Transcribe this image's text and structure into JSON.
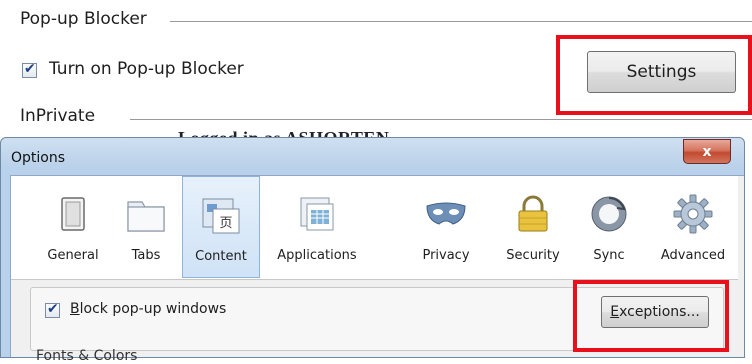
{
  "ie_panel": {
    "popup_section_title": "Pop-up Blocker",
    "popup_checkbox_label": "Turn on Pop-up Blocker",
    "popup_checked": true,
    "settings_button": "Settings",
    "inprivate_section_title": "InPrivate"
  },
  "background_text": "Logged in as ASHORTEN",
  "dialog": {
    "title": "Options",
    "close_glyph": "x",
    "tabs": [
      {
        "label": "General",
        "icon": "general-switch-icon"
      },
      {
        "label": "Tabs",
        "icon": "tabs-icon"
      },
      {
        "label": "Content",
        "icon": "content-icon",
        "selected": true
      },
      {
        "label": "Applications",
        "icon": "applications-icon"
      },
      {
        "label": "Privacy",
        "icon": "privacy-mask-icon"
      },
      {
        "label": "Security",
        "icon": "security-padlock-icon"
      },
      {
        "label": "Sync",
        "icon": "sync-icon"
      },
      {
        "label": "Advanced",
        "icon": "advanced-gear-icon"
      }
    ],
    "block_popups_label": "Block pop-up windows",
    "block_popups_checked": true,
    "exceptions_button_pre": "",
    "exceptions_button_access": "E",
    "exceptions_button_post": "xceptions...",
    "cut_off_text": "Fonts & Colors"
  },
  "colors": {
    "highlight_red": "#e8101b",
    "dialog_frame": "#b9d1ea",
    "close_button": "#c24a30"
  }
}
